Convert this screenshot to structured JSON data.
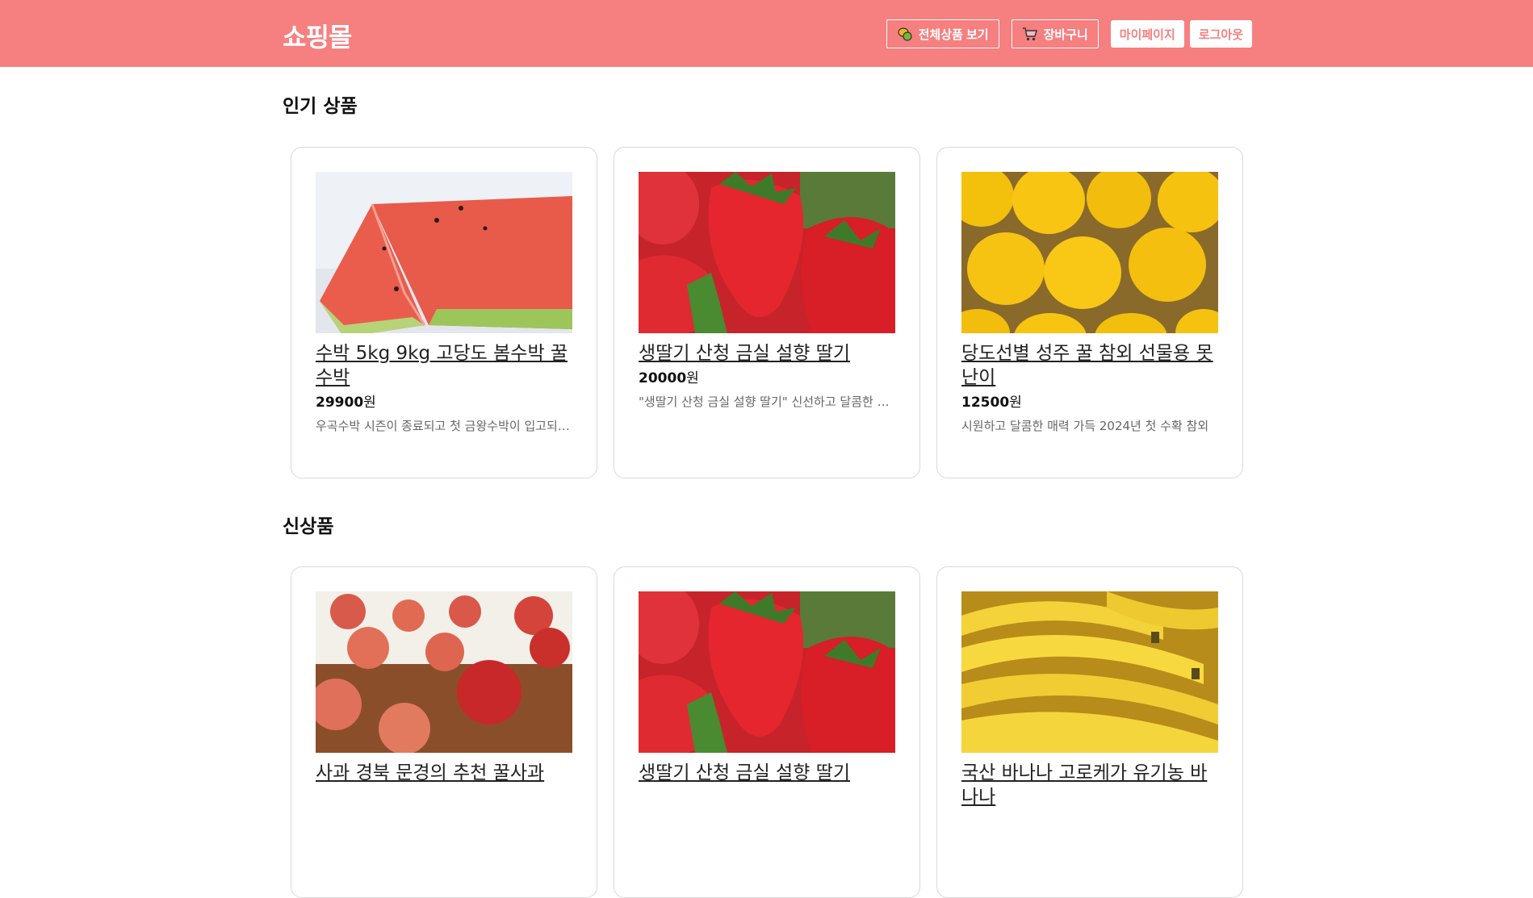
{
  "header": {
    "logo": "쇼핑몰",
    "nav": {
      "all_products": "전체상품 보기",
      "cart": "장바구니",
      "mypage": "마이페이지",
      "logout": "로그아웃"
    },
    "colors": {
      "brand": "#f67f7f",
      "white": "#ffffff"
    }
  },
  "popular": {
    "title": "인기 상품",
    "items": [
      {
        "image": "watermelon",
        "name": "수박 5kg 9kg 고당도 봄수박 꿀수박",
        "price": "29900",
        "currency": "원",
        "desc": "우곡수박 시즌이 종료되고 첫 금왕수박이 입고되었습니다"
      },
      {
        "image": "strawberry",
        "name": "생딸기 산청 금실 설향 딸기",
        "price": "20000",
        "currency": "원",
        "desc": "\"생딸기 산청 금실 설향 딸기\" 신선하고 달콤한 딸기"
      },
      {
        "image": "korean-melon",
        "name": "당도선별 성주 꿀 참외 선물용 못난이",
        "price": "12500",
        "currency": "원",
        "desc": "시원하고 달콤한 매력 가득 2024년 첫 수확 참외"
      }
    ]
  },
  "new": {
    "title": "신상품",
    "items": [
      {
        "image": "apple",
        "name": "사과 경북 문경의 추천 꿀사과"
      },
      {
        "image": "strawberry",
        "name": "생딸기 산청 금실 설향 딸기"
      },
      {
        "image": "banana",
        "name": "국산 바나나 고로케가 유기농 바나나"
      }
    ]
  }
}
